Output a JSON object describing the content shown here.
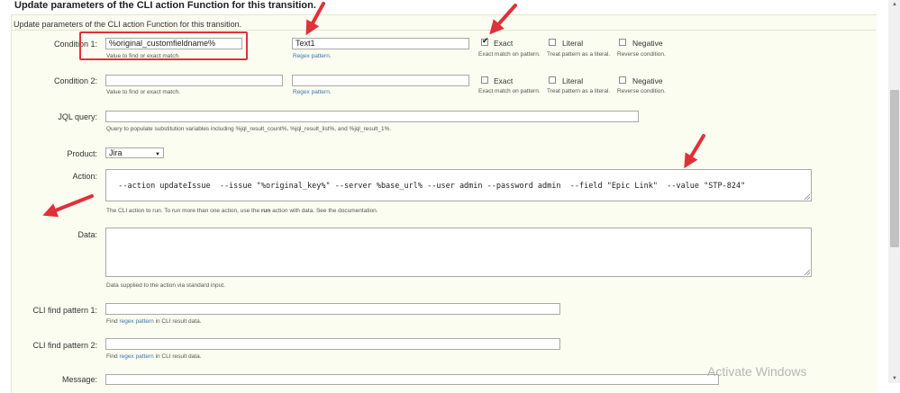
{
  "page_title": "Update parameters of the CLI action Function for this transition.",
  "panel_header": "Update parameters of the CLI action Function for this transition.",
  "condition1": {
    "label": "Condition 1:",
    "value": "%original_customfieldname%",
    "value_help": "Value to find or exact match.",
    "regex": "Text1",
    "regex_help": "Regex pattern.",
    "exact": {
      "label": "Exact",
      "help": "Exact match on pattern.",
      "checked": true,
      "check_glyph": "✔"
    },
    "literal": {
      "label": "Literal",
      "help": "Treat pattern as a literal.",
      "checked": false
    },
    "negative": {
      "label": "Negative",
      "help": "Reverse condition.",
      "checked": false
    }
  },
  "condition2": {
    "label": "Condition 2:",
    "value": "",
    "value_help": "Value to find or exact match.",
    "regex": "",
    "regex_help": "Regex pattern.",
    "exact": {
      "label": "Exact",
      "help": "Exact match on pattern.",
      "checked": false
    },
    "literal": {
      "label": "Literal",
      "help": "Treat pattern as a literal.",
      "checked": false
    },
    "negative": {
      "label": "Negative",
      "help": "Reverse condition.",
      "checked": false
    }
  },
  "jql": {
    "label": "JQL query:",
    "value": "",
    "help": "Query to populate substitution variables including %jql_result_count%, %jql_result_list%, and %jql_result_1%."
  },
  "product": {
    "label": "Product:",
    "selected": "Jira"
  },
  "action": {
    "label": "Action:",
    "value": "--action updateIssue  --issue \"%original_key%\" --server %base_url% --user admin --password admin  --field \"Epic Link\"  --value \"STP-824\"",
    "help_before": "The CLI action to run. To run more than one action, use the ",
    "help_bold": "run",
    "help_after": " action with data. See the documentation."
  },
  "data": {
    "label": "Data:",
    "value": "",
    "help": "Data supplied to the action via standard input."
  },
  "cli_find1": {
    "label": "CLI find pattern 1:",
    "value": "",
    "help_before": "Find ",
    "help_link": "regex pattern",
    "help_after": " in CLI result data."
  },
  "cli_find2": {
    "label": "CLI find pattern 2:",
    "value": "",
    "help_before": "Find ",
    "help_link": "regex pattern",
    "help_after": " in CLI result data."
  },
  "message": {
    "label": "Message:"
  },
  "watermark": "Activate Windows",
  "colors": {
    "annotation_red": "#e0303a",
    "link_blue": "#3b73af",
    "panel_bg": "#fafdf0"
  }
}
